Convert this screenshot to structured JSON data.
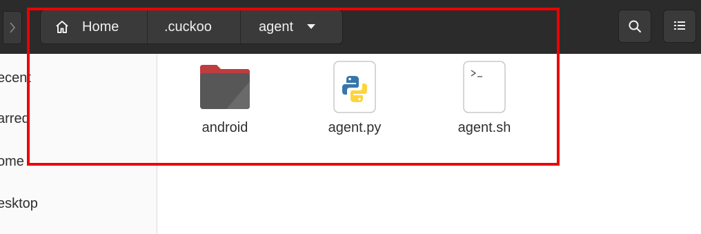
{
  "header": {
    "breadcrumbs": [
      {
        "label": "Home",
        "icon": "home-icon"
      },
      {
        "label": ".cuckoo"
      },
      {
        "label": "agent",
        "icon": "chevron-down-icon"
      }
    ],
    "buttons": {
      "forward_icon": "chevron-right-icon",
      "search_icon": "search-icon",
      "view_icon": "list-view-icon"
    }
  },
  "sidebar": {
    "items": [
      {
        "label": "ecent"
      },
      {
        "label": "arred"
      },
      {
        "label": "ome"
      },
      {
        "label": "esktop"
      }
    ]
  },
  "files": [
    {
      "name": "android",
      "icon": "folder-icon"
    },
    {
      "name": "agent.py",
      "icon": "python-file-icon"
    },
    {
      "name": "agent.sh",
      "icon": "shell-script-icon"
    }
  ],
  "colors": {
    "highlight": "#ee0000",
    "headerbar": "#2b2b2b",
    "folder_accent": "#e95420"
  }
}
